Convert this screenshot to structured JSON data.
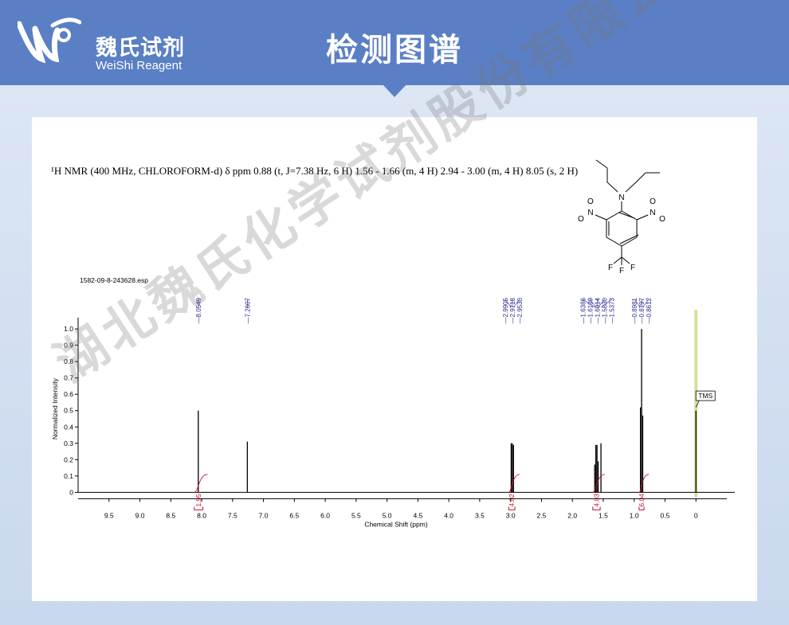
{
  "header": {
    "brand_cn": "魏氏试剂",
    "brand_en": "WeiShi Reagent",
    "title": "检测图谱"
  },
  "watermark": "湖北魏氏化学试剂股份有限公司",
  "chart_data": {
    "type": "line",
    "title": "¹H NMR (400 MHz, CHLOROFORM-d) δ ppm 0.88 (t, J=7.38 Hz, 6 H) 1.56 - 1.66 (m, 4 H) 2.94 - 3.00 (m, 4 H) 8.05 (s, 2 H)",
    "file_label": "1582-09-8-243628.esp",
    "xlabel": "Chemical Shift (ppm)",
    "ylabel": "Normalized Intensity",
    "xlim": [
      10.0,
      -0.5
    ],
    "ylim": [
      -0.12,
      1.02
    ],
    "x_ticks": [
      9.5,
      9.0,
      8.5,
      8.0,
      7.5,
      7.0,
      6.5,
      6.0,
      5.5,
      5.0,
      4.5,
      4.0,
      3.5,
      3.0,
      2.5,
      2.0,
      1.5,
      1.0,
      0.5,
      0
    ],
    "y_ticks": [
      0,
      0.1,
      0.2,
      0.3,
      0.4,
      0.5,
      0.6,
      0.7,
      0.8,
      0.9,
      1.0
    ],
    "peaks": [
      {
        "ppm": 8.0549,
        "intensity": 0.5
      },
      {
        "ppm": 7.2607,
        "intensity": 0.31
      },
      {
        "ppm": 2.9905,
        "intensity": 0.3
      },
      {
        "ppm": 2.9718,
        "intensity": 0.3
      },
      {
        "ppm": 2.953,
        "intensity": 0.29
      },
      {
        "ppm": 1.6386,
        "intensity": 0.17
      },
      {
        "ppm": 1.6199,
        "intensity": 0.29
      },
      {
        "ppm": 1.6014,
        "intensity": 0.29
      },
      {
        "ppm": 1.583,
        "intensity": 0.19
      },
      {
        "ppm": 1.5373,
        "intensity": 0.3
      },
      {
        "ppm": 0.8981,
        "intensity": 0.52
      },
      {
        "ppm": 0.8797,
        "intensity": 1.0
      },
      {
        "ppm": 0.8612,
        "intensity": 0.47
      },
      {
        "ppm": 0.0,
        "intensity": 0.5
      }
    ],
    "peak_label_groups": [
      {
        "labels": [
          "8.0549"
        ]
      },
      {
        "labels": [
          "7.2607"
        ]
      },
      {
        "labels": [
          "2.9905",
          "2.9718",
          "2.9530"
        ]
      },
      {
        "labels": [
          "1.6386",
          "1.6199",
          "1.6014",
          "1.5830",
          "1.5373"
        ]
      },
      {
        "labels": [
          "0.8981",
          "0.8797",
          "0.8612"
        ]
      }
    ],
    "integrations": [
      {
        "from": 8.12,
        "to": 7.98,
        "value": "1.95"
      },
      {
        "from": 3.03,
        "to": 2.93,
        "value": "4.02"
      },
      {
        "from": 1.67,
        "to": 1.55,
        "value": "4.03"
      },
      {
        "from": 0.92,
        "to": 0.84,
        "value": "6.04"
      }
    ],
    "tms_label": "TMS",
    "structure_labels": {
      "n": "N",
      "no2_left_n": "N",
      "no2_left_o1": "O",
      "no2_left_o2": "O",
      "no2_right_n": "N",
      "no2_right_o1": "O",
      "no2_right_o2": "O",
      "f1": "F",
      "f2": "F",
      "f3": "F"
    },
    "colors": {
      "spectrum": "#000000",
      "peak_label": "#2b2b8f",
      "integration": "#c8102e",
      "tms_band": "#d8df9a"
    }
  }
}
